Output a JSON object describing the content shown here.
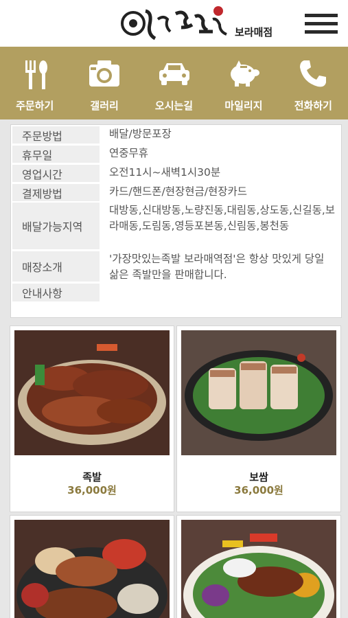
{
  "header": {
    "logo_text": "가장맛있는족발",
    "branch": "보라매점"
  },
  "nav": [
    {
      "label": "주문하기",
      "icon": "fork-spoon-icon"
    },
    {
      "label": "갤러리",
      "icon": "camera-icon"
    },
    {
      "label": "오시는길",
      "icon": "car-icon"
    },
    {
      "label": "마일리지",
      "icon": "piggy-bank-icon"
    },
    {
      "label": "전화하기",
      "icon": "phone-icon"
    }
  ],
  "info": [
    {
      "key": "주문방법",
      "value": "배달/방문포장"
    },
    {
      "key": "휴무일",
      "value": "연중무휴"
    },
    {
      "key": "영업시간",
      "value": "오전11시~새벽1시30분"
    },
    {
      "key": "결제방법",
      "value": "카드/핸드폰/현장현금/현장카드"
    },
    {
      "key": "배달가능지역",
      "value": "대방동,신대방동,노량진동,대림동,상도동,신길동,보라매동,도림동,영등포본동,신림동,봉천동"
    },
    {
      "key": "매장소개",
      "value": "'가장맛있는족발 보라매역점'은 항상 맛있게 당일 삶은 족발만을 판매합니다."
    },
    {
      "key": "안내사항",
      "value": ""
    }
  ],
  "products": [
    {
      "name": "족발",
      "price": "36,000원"
    },
    {
      "name": "보쌈",
      "price": "36,000원"
    },
    {
      "name": "",
      "price": ""
    },
    {
      "name": "",
      "price": ""
    }
  ],
  "colors": {
    "nav_bg": "#b29f60",
    "price": "#8b7a3e"
  }
}
